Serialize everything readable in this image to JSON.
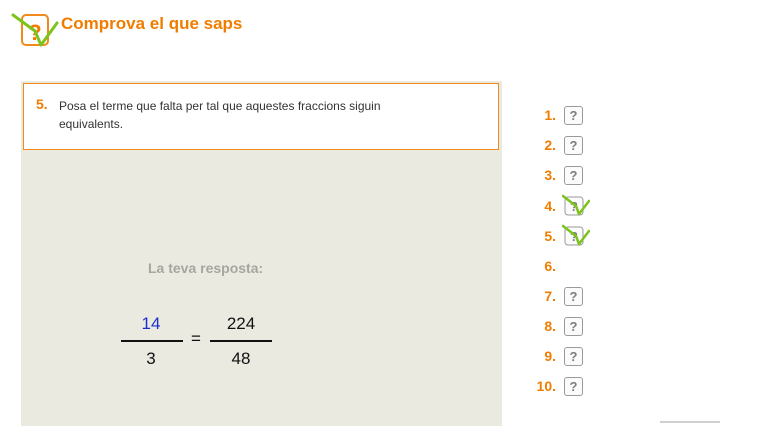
{
  "header": {
    "title": "Comprova el que saps",
    "logo_icon": "question-check-icon"
  },
  "question": {
    "number": "5.",
    "text": "Posa el terme que falta per tal que aquestes fraccions siguin equivalents."
  },
  "answer": {
    "label": "La teva resposta:",
    "left_fraction": {
      "numerator": "14",
      "denominator": "3"
    },
    "equals": "=",
    "right_fraction": {
      "numerator": "224",
      "denominator": "48"
    }
  },
  "question_list": {
    "items": [
      {
        "label": "1.",
        "status": "unanswered",
        "icon": "question-icon"
      },
      {
        "label": "2.",
        "status": "unanswered",
        "icon": "question-icon"
      },
      {
        "label": "3.",
        "status": "unanswered",
        "icon": "question-icon"
      },
      {
        "label": "4.",
        "status": "answered",
        "icon": "question-check-icon"
      },
      {
        "label": "5.",
        "status": "answered",
        "icon": "question-check-icon"
      },
      {
        "label": "6.",
        "status": "current",
        "icon": ""
      },
      {
        "label": "7.",
        "status": "unanswered",
        "icon": "question-icon"
      },
      {
        "label": "8.",
        "status": "unanswered",
        "icon": "question-icon"
      },
      {
        "label": "9.",
        "status": "unanswered",
        "icon": "question-icon"
      },
      {
        "label": "10.",
        "status": "unanswered",
        "icon": "question-icon"
      }
    ]
  },
  "badge_glyph": "?",
  "colors": {
    "accent_orange": "#f07d00",
    "panel_bg": "#ebeae1",
    "answer_blue": "#1a2fcf",
    "check_green": "#7cc41d"
  }
}
